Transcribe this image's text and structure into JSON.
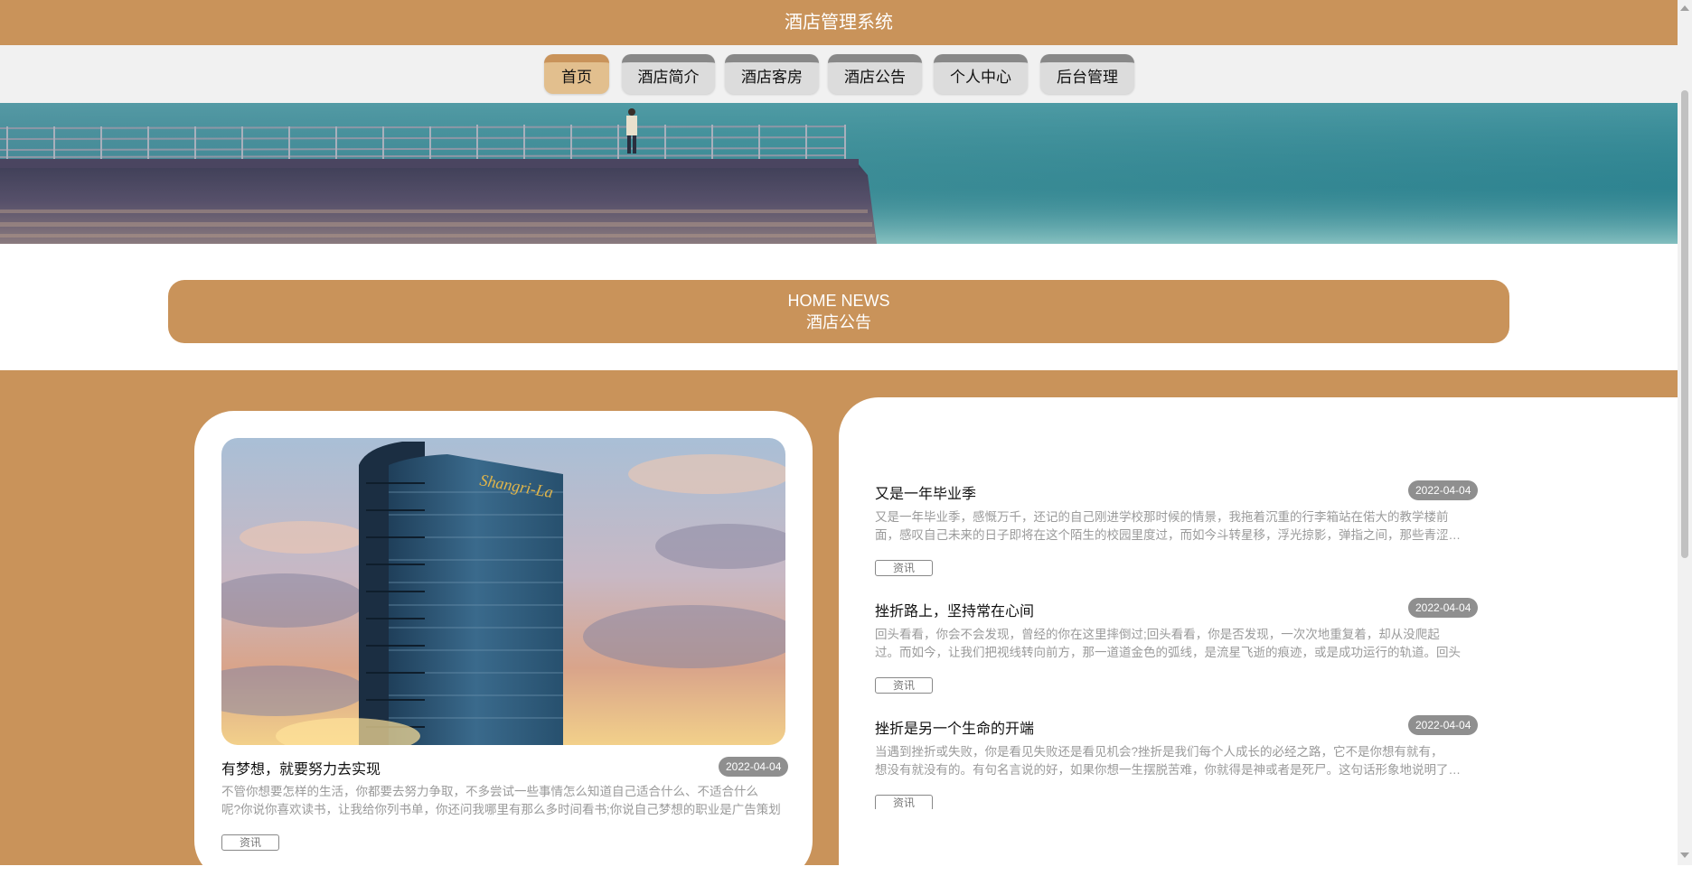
{
  "app": {
    "title": "酒店管理系统"
  },
  "nav": {
    "items": [
      {
        "label": "首页",
        "active": true
      },
      {
        "label": "酒店简介",
        "active": false
      },
      {
        "label": "酒店客房",
        "active": false
      },
      {
        "label": "酒店公告",
        "active": false
      },
      {
        "label": "个人中心",
        "active": false
      },
      {
        "label": "后台管理",
        "active": false
      }
    ]
  },
  "section": {
    "title_en": "HOME NEWS",
    "title_zh": "酒店公告"
  },
  "featured": {
    "title": "有梦想，就要努力去实现",
    "date": "2022-04-04",
    "desc_line1": "不管你想要怎样的生活，你都要去努力争取，不多尝试一些事情怎么知道自己适合什么、不适合什么",
    "desc_line2": "呢?你说你喜欢读书，让我给你列书单，你还问我哪里有那么多时间看书;你说自己梦想的职业是广告策划",
    "tag": "资讯",
    "image_sign": "Shangri-La"
  },
  "news": [
    {
      "title": "又是一年毕业季",
      "date": "2022-04-04",
      "desc_line1": "又是一年毕业季，感慨万千，还记的自己刚进学校那时候的情景，我拖着沉重的行李箱站在偌大的教学楼前",
      "desc_line2": "面，感叹自己未来的日子即将在这个陌生的校园里度过，而如今斗转星移，浮光掠影，弹指之间，那些青涩的时光",
      "tag": "资讯"
    },
    {
      "title": "挫折路上，坚持常在心间",
      "date": "2022-04-04",
      "desc_line1": "回头看看，你会不会发现，曾经的你在这里摔倒过;回头看看，你是否发现，一次次地重复着，却从没爬起",
      "desc_line2": "过。而如今，让我们把视线转向前方，那一道道金色的弧线，是流星飞逝的痕迹，或是成功运行的轨道。回头",
      "tag": "资讯"
    },
    {
      "title": "挫折是另一个生命的开端",
      "date": "2022-04-04",
      "desc_line1": "当遇到挫折或失败，你是看见失败还是看见机会?挫折是我们每个人成长的必经之路，它不是你想有就有，",
      "desc_line2": "想没有就没有的。有句名言说的好，如果你想一生摆脱苦难，你就得是神或者是死尸。这句话形象地说明了挫折",
      "tag": "资讯"
    }
  ],
  "colors": {
    "brand": "#c9935a",
    "active_nav": "#e2bf8e",
    "badge": "#8f8f8f"
  }
}
